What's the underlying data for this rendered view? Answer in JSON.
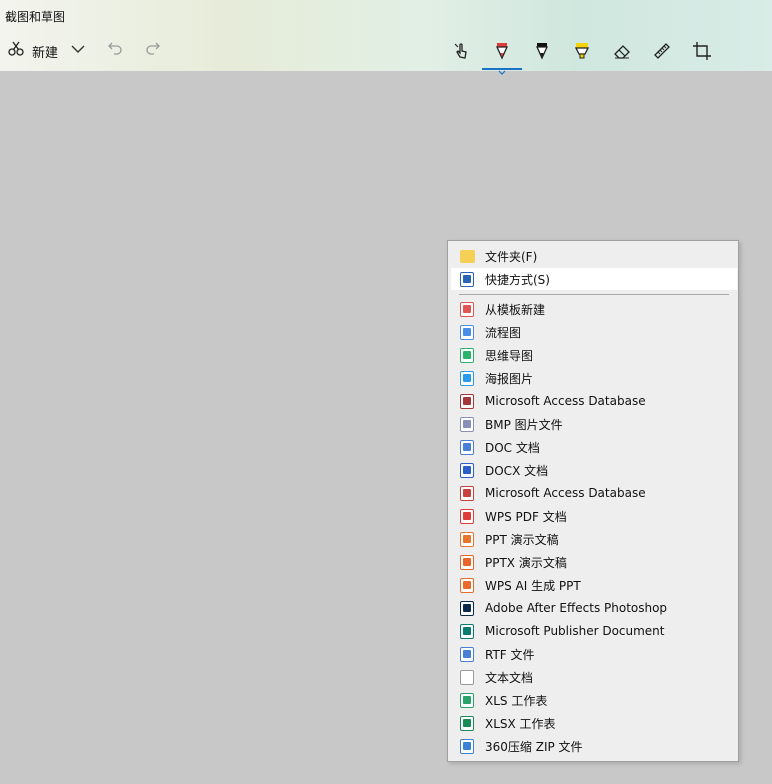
{
  "app": {
    "title": "截图和草图"
  },
  "toolbar": {
    "new_label": "新建",
    "tools": [
      {
        "icon": "touch-writing-icon"
      },
      {
        "icon": "ballpoint-pen-icon",
        "color": "#e23b3b"
      },
      {
        "icon": "pencil-icon",
        "color": "#111111"
      },
      {
        "icon": "highlighter-icon",
        "color": "#f5d30a"
      },
      {
        "icon": "eraser-icon"
      },
      {
        "icon": "ruler-icon"
      },
      {
        "icon": "crop-icon"
      }
    ]
  },
  "context_menu": {
    "items": [
      {
        "label": "文件夹(F)",
        "icon": "folder-icon",
        "color": "#f6cf57"
      },
      {
        "label": "快捷方式(S)",
        "icon": "shortcut-icon",
        "color": "#2a63b8",
        "highlighted": true
      },
      {
        "label": "从模板新建",
        "icon": "template-icon",
        "color": "#e05555"
      },
      {
        "label": "流程图",
        "icon": "flowchart-icon",
        "color": "#4a8ee8"
      },
      {
        "label": "思维导图",
        "icon": "mindmap-icon",
        "color": "#29b36b"
      },
      {
        "label": "海报图片",
        "icon": "poster-icon",
        "color": "#2a9bea"
      },
      {
        "label": "Microsoft Access Database",
        "icon": "access-icon",
        "color": "#a4373a"
      },
      {
        "label": "BMP 图片文件",
        "icon": "bmp-icon",
        "color": "#8a8fb8"
      },
      {
        "label": "DOC 文档",
        "icon": "doc-icon",
        "color": "#4a7fd8"
      },
      {
        "label": "DOCX 文档",
        "icon": "docx-icon",
        "color": "#2b5fc8"
      },
      {
        "label": "Microsoft Access Database",
        "icon": "access-icon-2",
        "color": "#c94040"
      },
      {
        "label": "WPS PDF 文档",
        "icon": "pdf-icon",
        "color": "#e03c3c"
      },
      {
        "label": "PPT 演示文稿",
        "icon": "ppt-icon",
        "color": "#e8772e"
      },
      {
        "label": "PPTX 演示文稿",
        "icon": "pptx-icon",
        "color": "#e8662a"
      },
      {
        "label": "WPS AI 生成 PPT",
        "icon": "wps-ai-ppt-icon",
        "color": "#ea6a2c"
      },
      {
        "label": "Adobe After Effects Photoshop",
        "icon": "photoshop-icon",
        "color": "#0d2a4a"
      },
      {
        "label": "Microsoft Publisher Document",
        "icon": "publisher-icon",
        "color": "#0a7b6e"
      },
      {
        "label": "RTF 文件",
        "icon": "rtf-icon",
        "color": "#4a7fd8"
      },
      {
        "label": "文本文档",
        "icon": "text-document-icon",
        "color": "#9a9a9a"
      },
      {
        "label": "XLS 工作表",
        "icon": "xls-icon",
        "color": "#2aa36b"
      },
      {
        "label": "XLSX 工作表",
        "icon": "xlsx-icon",
        "color": "#1a8a56"
      },
      {
        "label": "360压缩 ZIP 文件",
        "icon": "zip-archive-icon",
        "color": "#3b82d6"
      }
    ]
  }
}
